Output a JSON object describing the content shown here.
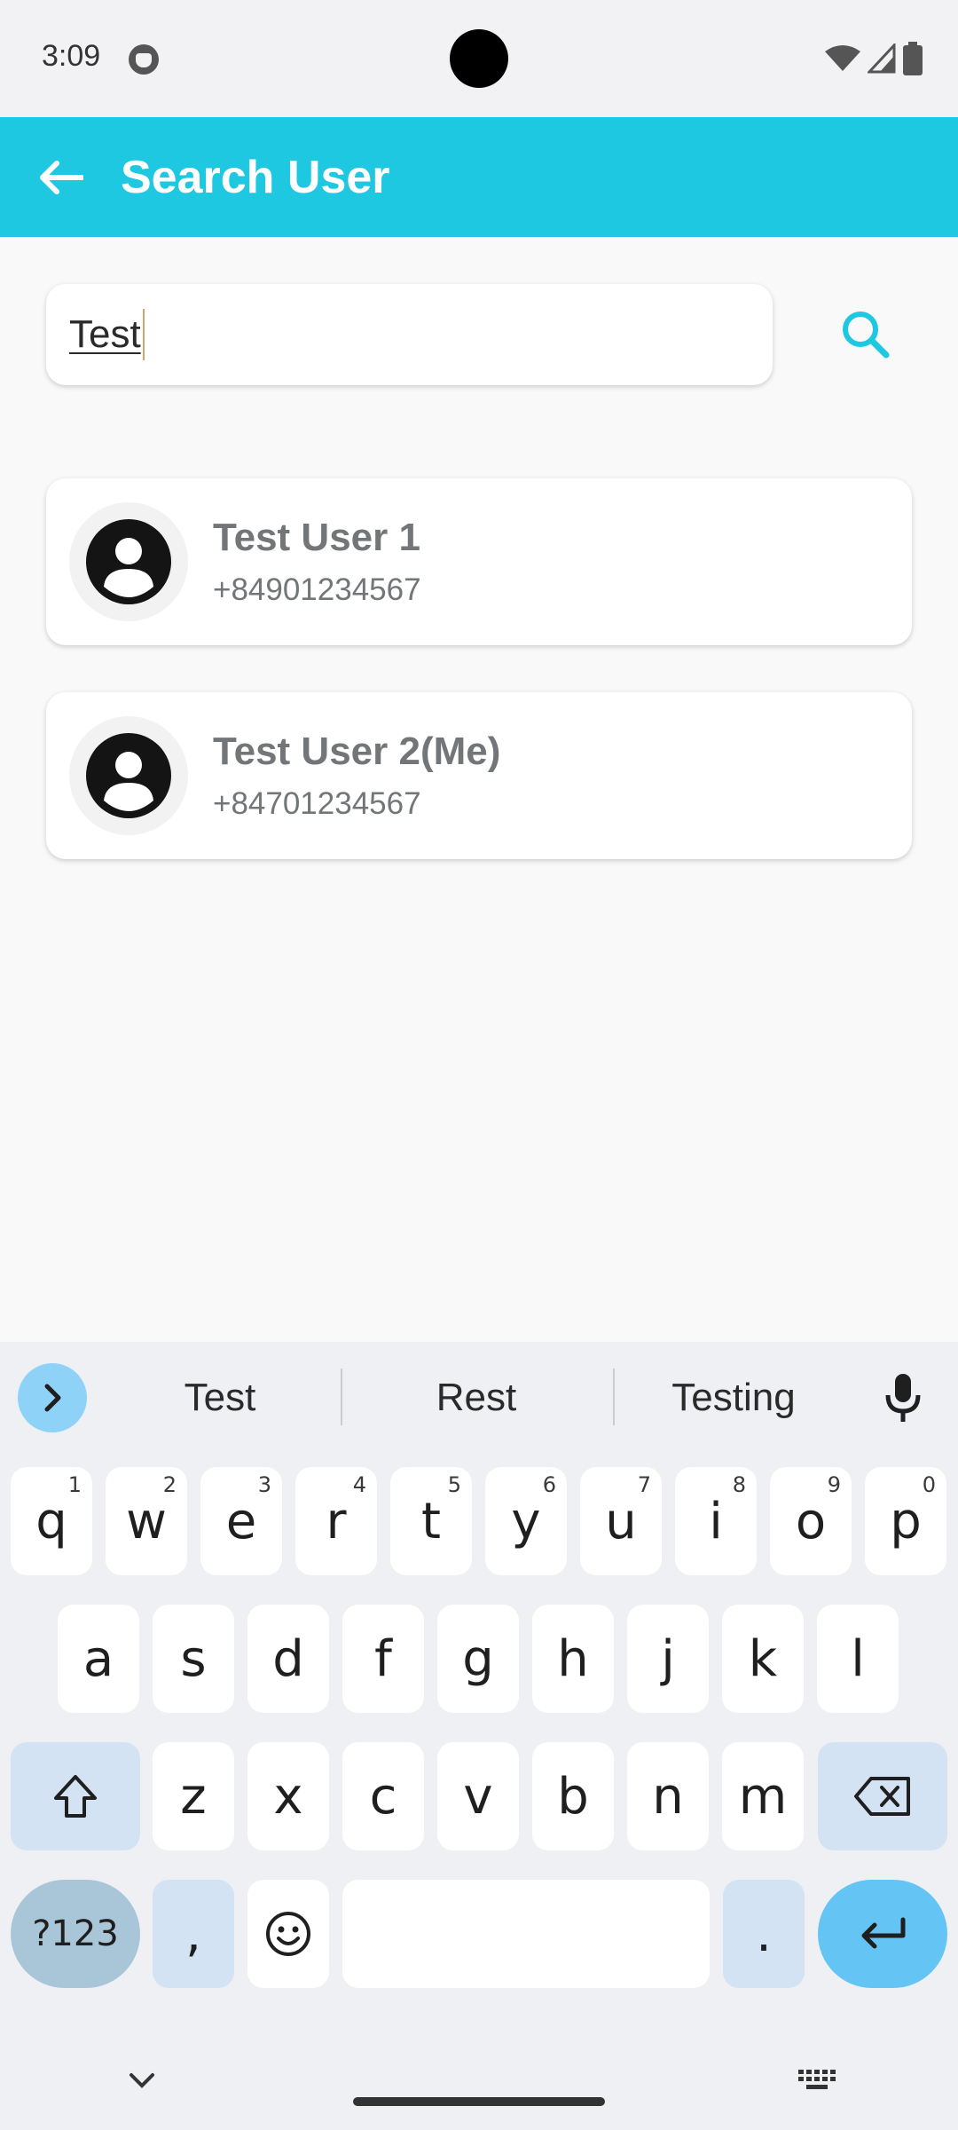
{
  "status_bar": {
    "time": "3:09",
    "icons": [
      "face-icon",
      "wifi-icon",
      "cell-signal-icon",
      "battery-icon"
    ]
  },
  "app_bar": {
    "title": "Search User",
    "back_icon": "arrow-left-icon"
  },
  "search": {
    "value": "Test",
    "button_icon": "search-icon",
    "accent": "#1ec8e1"
  },
  "results": [
    {
      "name": "Test User 1",
      "phone": "+84901234567"
    },
    {
      "name": "Test User 2(Me)",
      "phone": "+84701234567"
    }
  ],
  "keyboard": {
    "suggestions": [
      "Test",
      "Rest",
      "Testing"
    ],
    "row1": [
      {
        "k": "q",
        "h": "1"
      },
      {
        "k": "w",
        "h": "2"
      },
      {
        "k": "e",
        "h": "3"
      },
      {
        "k": "r",
        "h": "4"
      },
      {
        "k": "t",
        "h": "5"
      },
      {
        "k": "y",
        "h": "6"
      },
      {
        "k": "u",
        "h": "7"
      },
      {
        "k": "i",
        "h": "8"
      },
      {
        "k": "o",
        "h": "9"
      },
      {
        "k": "p",
        "h": "0"
      }
    ],
    "row2": [
      "a",
      "s",
      "d",
      "f",
      "g",
      "h",
      "j",
      "k",
      "l"
    ],
    "row3": [
      "z",
      "x",
      "c",
      "v",
      "b",
      "n",
      "m"
    ],
    "symbols_label": "?123",
    "comma": ",",
    "period": "."
  },
  "colors": {
    "app_bar": "#1ec8e1",
    "keyboard_bg": "#eff0f4",
    "enter_key": "#64c5f5"
  }
}
